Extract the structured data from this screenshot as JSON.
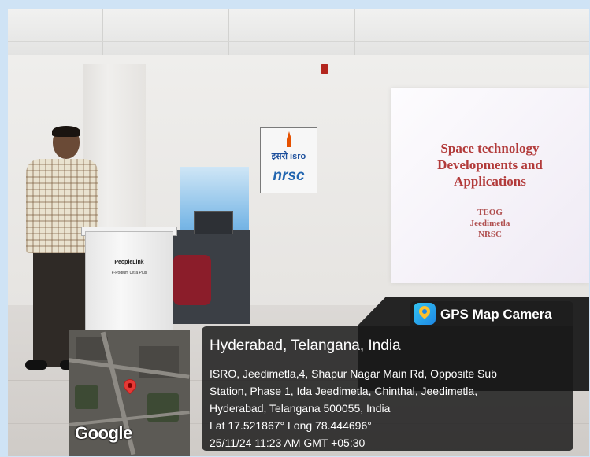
{
  "photo": {
    "slide": {
      "title_lines": [
        "Space technology",
        "Developments and",
        "Applications"
      ],
      "sub_lines": [
        "TEOG",
        "Jeedimetla",
        "NRSC"
      ]
    },
    "logo": {
      "isro": "इसरो isro",
      "nrsc": "nrsc"
    },
    "podium": {
      "brand": "PeopleLink",
      "tagline": "e-Podium Ultra Plus"
    },
    "map_attribution": "Google"
  },
  "gps_stamp": {
    "app_name": "GPS Map Camera",
    "location_title": "Hyderabad, Telangana, India",
    "address_lines": [
      "ISRO, Jeedimetla,4, Shapur Nagar Main Rd, Opposite Sub",
      "Station, Phase 1, Ida Jeedimetla, Chinthal, Jeedimetla,",
      "Hyderabad, Telangana 500055, India"
    ],
    "coordinates": "Lat 17.521867° Long 78.444696°",
    "datetime": "25/11/24 11:23 AM GMT +05:30"
  },
  "colors": {
    "slide_text": "#b23a3a",
    "overlay": "#191919",
    "pin": "#e53935"
  }
}
